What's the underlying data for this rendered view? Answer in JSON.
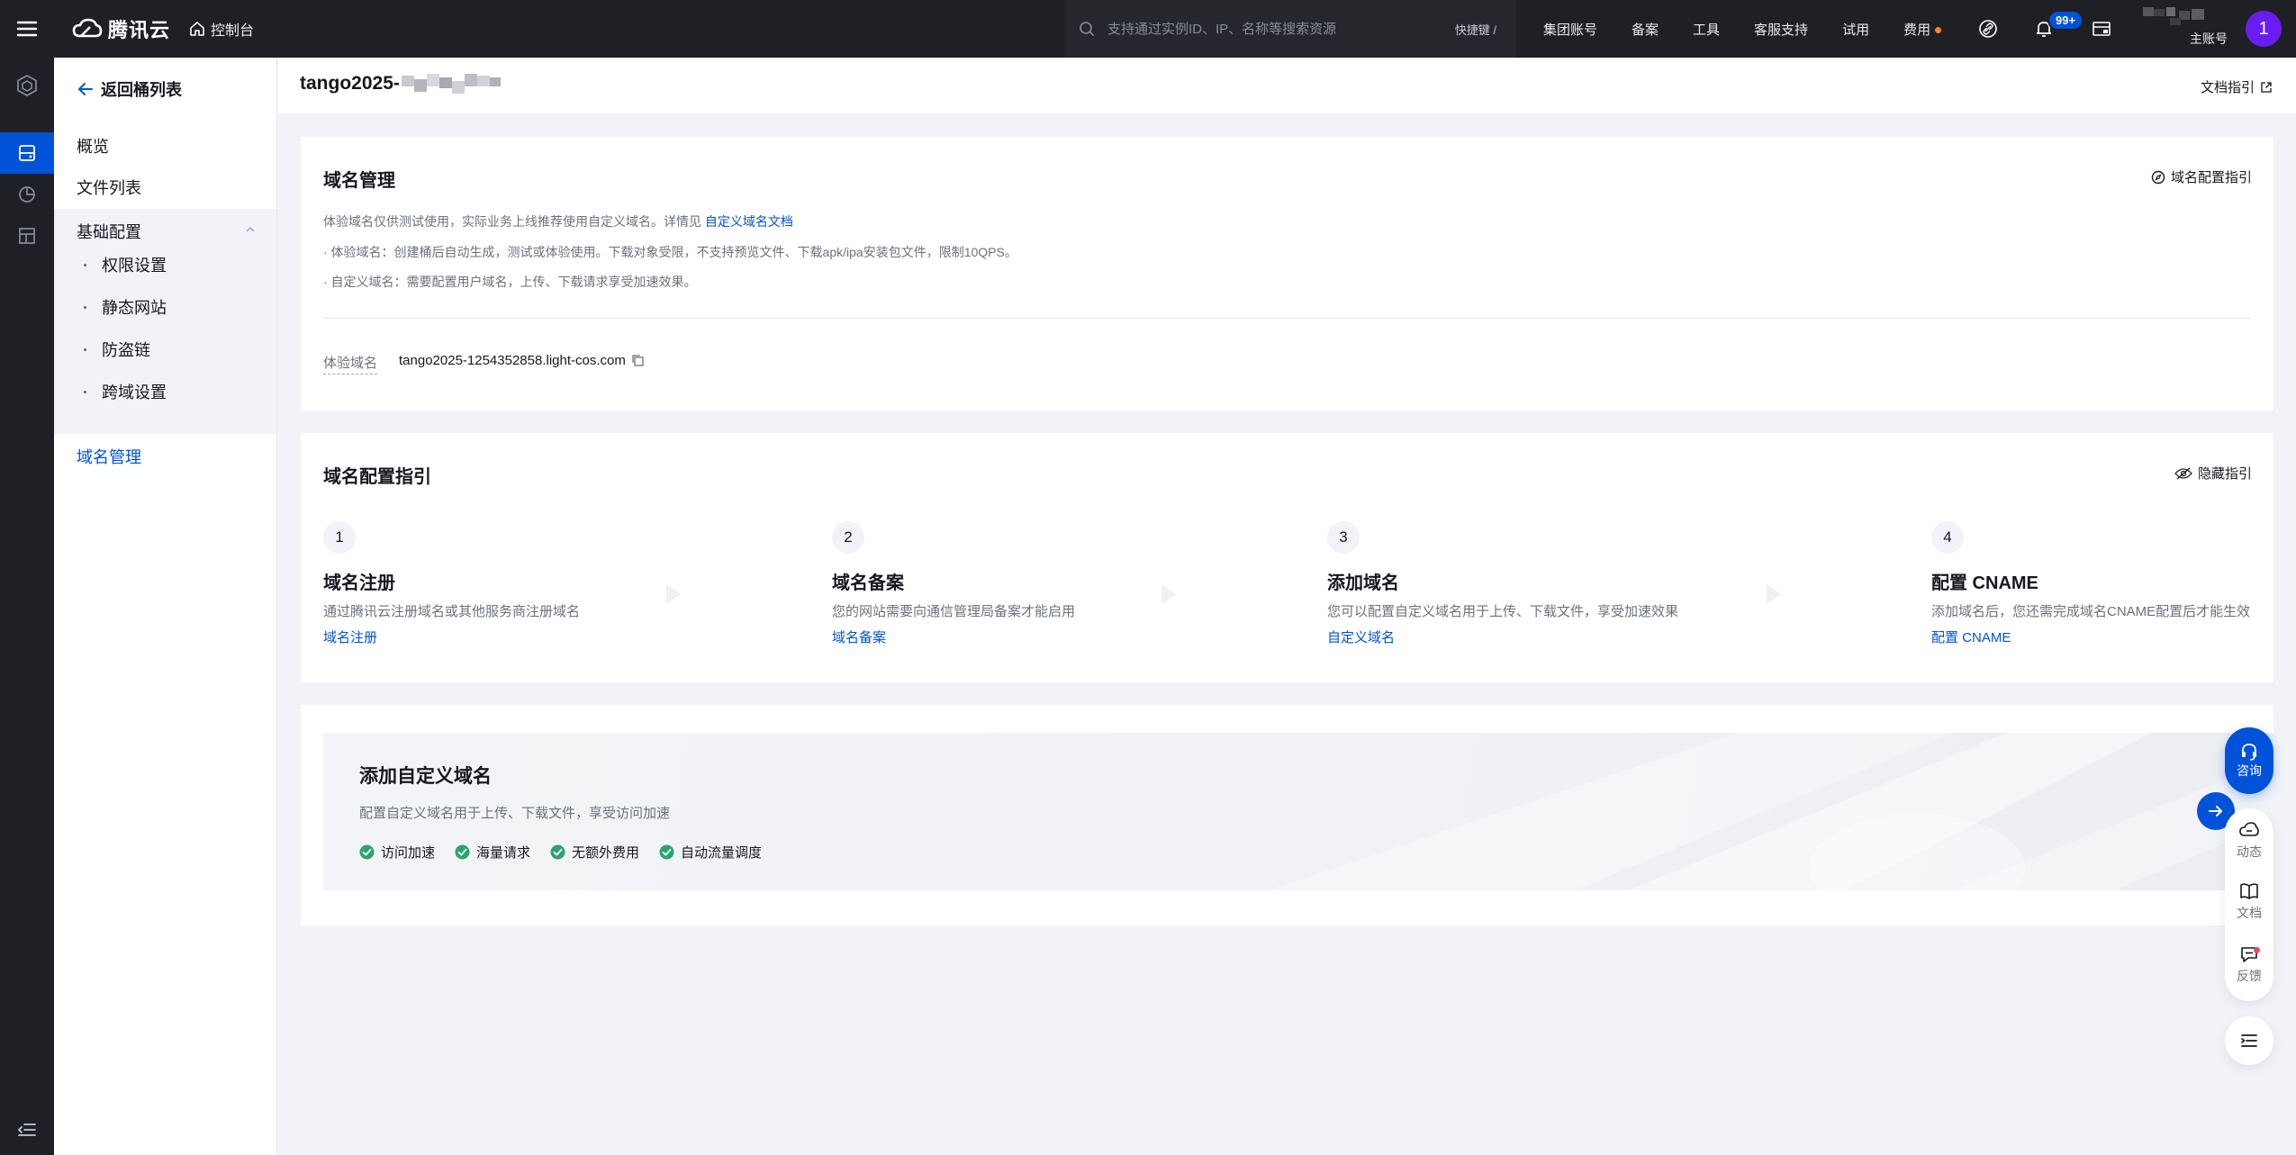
{
  "topbar": {
    "brand": "腾讯云",
    "console_label": "控制台",
    "search_placeholder": "支持通过实例ID、IP、名称等搜索资源",
    "shortcut": "快捷键 /",
    "nav": [
      "集团账号",
      "备案",
      "工具",
      "客服支持",
      "试用",
      "费用"
    ],
    "notification_count": "99+",
    "account_label": "主账号",
    "avatar_initial": "1"
  },
  "sidebar": {
    "back_label": "返回桶列表",
    "items": [
      "概览",
      "文件列表"
    ],
    "group": {
      "title": "基础配置",
      "items": [
        "权限设置",
        "静态网站",
        "防盗链",
        "跨域设置"
      ]
    },
    "active_item": "域名管理"
  },
  "header": {
    "bucket_prefix": "tango2025-",
    "doc_guide": "文档指引"
  },
  "domain_card": {
    "title": "域名管理",
    "guide_link": "域名配置指引",
    "intro": "体验域名仅供测试使用，实际业务上线推荐使用自定义域名。详情见",
    "intro_link": "自定义域名文档",
    "note_trial": "· 体验域名：创建桶后自动生成，测试或体验使用。下载对象受限，不支持预览文件、下载apk/ipa安装包文件，限制10QPS。",
    "note_custom": "· 自定义域名：需要配置用户域名，上传、下载请求享受加速效果。",
    "trial_label": "体验域名",
    "trial_value": "tango2025-1254352858.light-cos.com"
  },
  "guide_card": {
    "title": "域名配置指引",
    "hide_label": "隐藏指引",
    "steps": [
      {
        "num": "1",
        "title": "域名注册",
        "desc": "通过腾讯云注册域名或其他服务商注册域名",
        "link": "域名注册"
      },
      {
        "num": "2",
        "title": "域名备案",
        "desc": "您的网站需要向通信管理局备案才能启用",
        "link": "域名备案"
      },
      {
        "num": "3",
        "title": "添加域名",
        "desc": "您可以配置自定义域名用于上传、下载文件，享受加速效果",
        "link": "自定义域名"
      },
      {
        "num": "4",
        "title": "配置 CNAME",
        "desc": "添加域名后，您还需完成域名CNAME配置后才能生效",
        "link": "配置 CNAME"
      }
    ]
  },
  "custom_banner": {
    "title": "添加自定义域名",
    "desc": "配置自定义域名用于上传、下载文件，享受访问加速",
    "features": [
      "访问加速",
      "海量请求",
      "无额外费用",
      "自动流量调度"
    ]
  },
  "floating": {
    "consult": "咨询",
    "news": "动态",
    "docs": "文档",
    "feedback": "反馈"
  },
  "colors": {
    "brand": "#0052d9",
    "topbar": "#1f2025",
    "success": "#2ba471",
    "avatar": "#6a1df1"
  }
}
